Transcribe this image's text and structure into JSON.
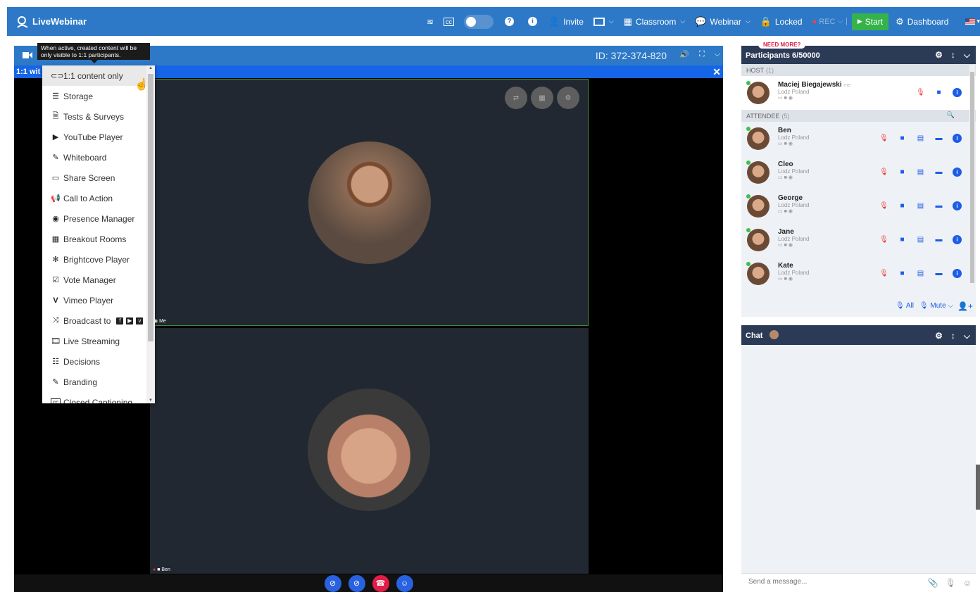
{
  "topbar": {
    "brand": "LiveWebinar",
    "invite": "Invite",
    "classroom": "Classroom",
    "webinar": "Webinar",
    "locked": "Locked",
    "rec": "REC",
    "start": "Start",
    "dashboard": "Dashboard"
  },
  "video": {
    "room_id": "ID: 372-374-820",
    "sub_label": "1:1 wit",
    "tile1_name": "Me",
    "tile2_name": "Ben"
  },
  "tooltip": {
    "text": "When active, created content will be only visible to 1:1 participants."
  },
  "menu": {
    "items": [
      {
        "label": "1:1 content only",
        "icon": "link-icon"
      },
      {
        "label": "Storage",
        "icon": "storage-icon"
      },
      {
        "label": "Tests & Surveys",
        "icon": "document-icon"
      },
      {
        "label": "YouTube Player",
        "icon": "youtube-icon"
      },
      {
        "label": "Whiteboard",
        "icon": "brush-icon"
      },
      {
        "label": "Share Screen",
        "icon": "monitor-icon"
      },
      {
        "label": "Call to Action",
        "icon": "megaphone-icon"
      },
      {
        "label": "Presence Manager",
        "icon": "eye-icon"
      },
      {
        "label": "Breakout Rooms",
        "icon": "grid-icon"
      },
      {
        "label": "Brightcove Player",
        "icon": "gear-icon"
      },
      {
        "label": "Vote Manager",
        "icon": "checkbox-icon"
      },
      {
        "label": "Vimeo Player",
        "icon": "vimeo-icon"
      },
      {
        "label": "Broadcast to",
        "icon": "shuffle-icon"
      },
      {
        "label": "Live Streaming",
        "icon": "film-icon"
      },
      {
        "label": "Decisions",
        "icon": "list-icon"
      },
      {
        "label": "Branding",
        "icon": "brush-icon"
      },
      {
        "label": "Closed Captioning",
        "icon": "cc-icon"
      }
    ]
  },
  "participants": {
    "need_more": "NEED MORE?",
    "title": "Participants 6/50000",
    "host_section": "HOST",
    "host_count": "(1)",
    "attendee_section": "ATTENDEE",
    "attendee_count": "(5)",
    "host": {
      "name": "Maciej Biegajewski",
      "me": "me",
      "location": "Lodz Poland"
    },
    "attendees": [
      {
        "name": "Ben",
        "location": "Lodz Poland"
      },
      {
        "name": "Cleo",
        "location": "Lodz Poland"
      },
      {
        "name": "George",
        "location": "Lodz Poland"
      },
      {
        "name": "Jane",
        "location": "Lodz Poland"
      },
      {
        "name": "Kate",
        "location": "Lodz Poland"
      }
    ],
    "footer_all": "All",
    "footer_mute": "Mute"
  },
  "chat": {
    "title": "Chat",
    "placeholder": "Send a message..."
  },
  "colors": {
    "brand_blue": "#2d79c7",
    "panel_dark": "#2b3a55",
    "start_green": "#35b34a",
    "accent_blue": "#1d5ce6"
  }
}
